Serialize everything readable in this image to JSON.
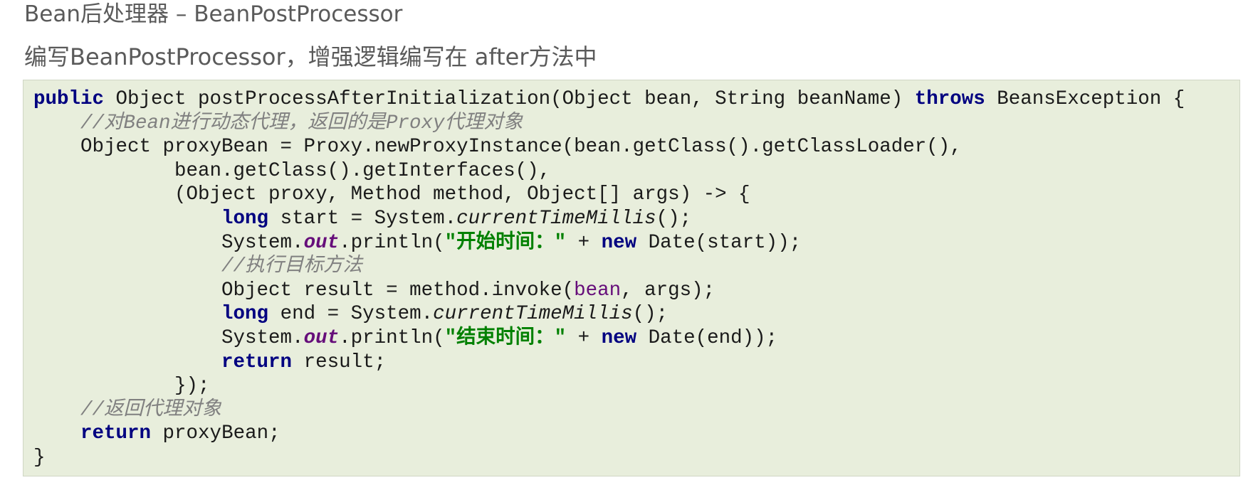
{
  "page": {
    "title": "Bean后处理器 – BeanPostProcessor",
    "subtitle": "编写BeanPostProcessor，增强逻辑编写在 after方法中"
  },
  "code": {
    "language": "java",
    "lines": [
      [
        {
          "t": "public",
          "s": "kw"
        },
        {
          "t": " Object postProcessAfterInitialization(Object bean, String beanName) "
        },
        {
          "t": "throws",
          "s": "kw"
        },
        {
          "t": " BeansException {"
        }
      ],
      [
        {
          "t": "    "
        },
        {
          "t": "//对Bean进行动态代理，返回的是Proxy代理对象",
          "s": "cm"
        }
      ],
      [
        {
          "t": "    Object proxyBean = Proxy.newProxyInstance(bean.getClass().getClassLoader(),"
        }
      ],
      [
        {
          "t": "            bean.getClass().getInterfaces(),"
        }
      ],
      [
        {
          "t": "            (Object proxy, Method method, Object[] args) -> {"
        }
      ],
      [
        {
          "t": "                "
        },
        {
          "t": "long",
          "s": "kw"
        },
        {
          "t": " start = System."
        },
        {
          "t": "currentTimeMillis",
          "s": "it"
        },
        {
          "t": "();"
        }
      ],
      [
        {
          "t": "                System."
        },
        {
          "t": "out",
          "s": "fld"
        },
        {
          "t": ".println("
        },
        {
          "t": "\"开始时间：\"",
          "s": "st"
        },
        {
          "t": " + "
        },
        {
          "t": "new",
          "s": "kw"
        },
        {
          "t": " Date(start));"
        }
      ],
      [
        {
          "t": "                "
        },
        {
          "t": "//执行目标方法",
          "s": "cm"
        }
      ],
      [
        {
          "t": "                Object result = method.invoke("
        },
        {
          "t": "bean",
          "s": "vr"
        },
        {
          "t": ", args);"
        }
      ],
      [
        {
          "t": "                "
        },
        {
          "t": "long",
          "s": "kw"
        },
        {
          "t": " end = System."
        },
        {
          "t": "currentTimeMillis",
          "s": "it"
        },
        {
          "t": "();"
        }
      ],
      [
        {
          "t": "                System."
        },
        {
          "t": "out",
          "s": "fld"
        },
        {
          "t": ".println("
        },
        {
          "t": "\"结束时间：\"",
          "s": "st"
        },
        {
          "t": " + "
        },
        {
          "t": "new",
          "s": "kw"
        },
        {
          "t": " Date(end));"
        }
      ],
      [
        {
          "t": "                "
        },
        {
          "t": "return",
          "s": "kw"
        },
        {
          "t": " result;"
        }
      ],
      [
        {
          "t": "            });"
        }
      ],
      [
        {
          "t": "    "
        },
        {
          "t": "//返回代理对象",
          "s": "cm"
        }
      ],
      [
        {
          "t": "    "
        },
        {
          "t": "return",
          "s": "kw"
        },
        {
          "t": " proxyBean;"
        }
      ],
      [
        {
          "t": "}"
        }
      ]
    ]
  }
}
